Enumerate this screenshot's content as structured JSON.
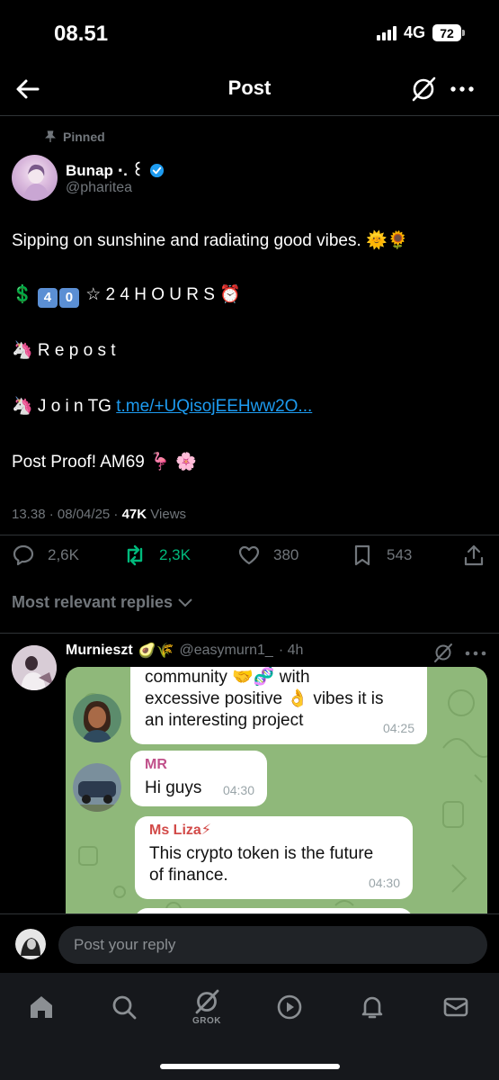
{
  "status_bar": {
    "time": "08.51",
    "network": "4G",
    "battery": "72"
  },
  "nav": {
    "title": "Post"
  },
  "post": {
    "pinned_label": "Pinned",
    "author_name": "Bunap ⋅. ꒰",
    "author_handle": "@pharitea",
    "line1": "Sipping on sunshine and radiating good vibes. 🌞🌻",
    "line2_prefix": "💲",
    "line2_digits": [
      "4",
      "0"
    ],
    "line2_text": "☆ 2 4 H O U R S ⏰",
    "line3": "🦄 R e p o s t",
    "line4_prefix": "🦄 J o i n TG",
    "line4_link": "t.me/+UQisojEEHww2O...",
    "line5": "Post Proof! AM69 🦩 🌸",
    "meta_date": "13.38 · 08/04/25 · ",
    "views_count": "47K",
    "views_label": "Views"
  },
  "actions": {
    "replies": "2,6K",
    "reposts": "2,3K",
    "likes": "380",
    "bookmarks": "543"
  },
  "relevant_label": "Most relevant replies",
  "reply": {
    "name": "Murnieszt",
    "emojis": "🥑🌾",
    "handle": "@easymurn1_",
    "time": "· 4h",
    "chat": {
      "bubble1_text": "community 🤝🧬 with\nexcessive positive 👌 vibes it is\nan interesting project",
      "bubble1_time": "04:25",
      "bubble2_sender": "MR",
      "bubble2_text": "Hi guys",
      "bubble2_time": "04:30",
      "bubble3_sender": "Ms Liza⚡",
      "bubble3_text": "This crypto token is the future\nof finance.",
      "bubble3_time": "04:30"
    }
  },
  "reply_input": {
    "placeholder": "Post your reply"
  },
  "tabs": {
    "grok_label": "GROK"
  },
  "colors": {
    "accent": "#1d9bf0",
    "repost_green": "#00ba7c",
    "chat_bg": "#8fb87a",
    "sender_mr": "#c0508a",
    "sender_liza": "#d24a48"
  }
}
